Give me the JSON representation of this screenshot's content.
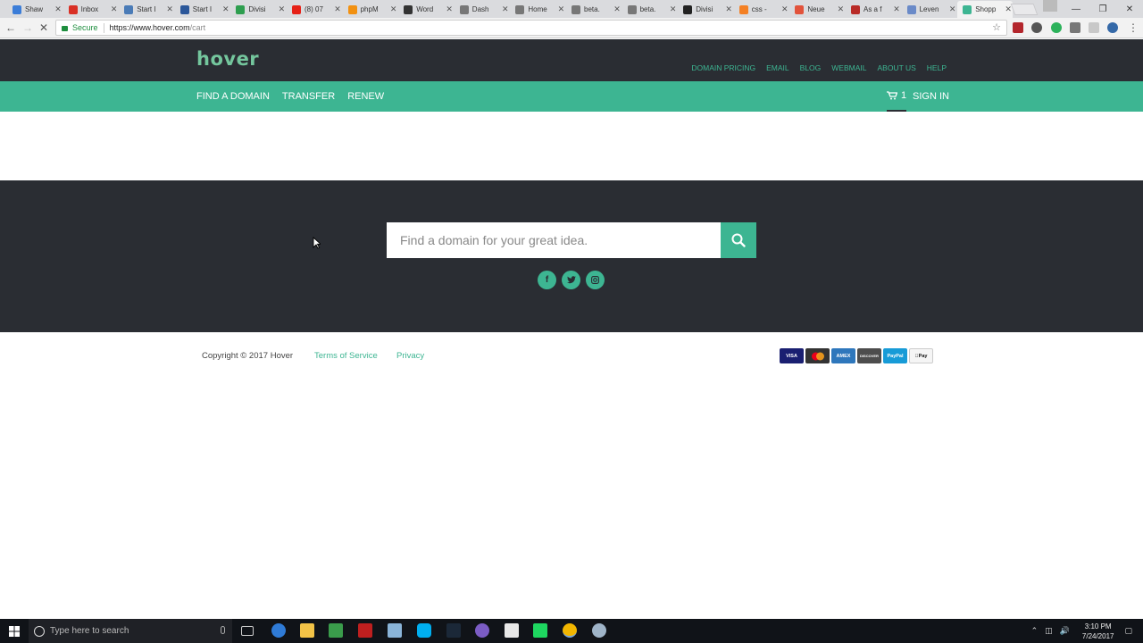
{
  "browser": {
    "tabs": [
      {
        "title": "Shaw",
        "color": "#3b7dd8"
      },
      {
        "title": "Inbox",
        "color": "#d93025"
      },
      {
        "title": "Start I",
        "color": "#4a7bb7"
      },
      {
        "title": "Start I",
        "color": "#2b579a"
      },
      {
        "title": "Divisi",
        "color": "#2e9e4f"
      },
      {
        "title": "(8) 07",
        "color": "#e62117"
      },
      {
        "title": "phpM",
        "color": "#f29111"
      },
      {
        "title": "Word",
        "color": "#333333"
      },
      {
        "title": "Dash",
        "color": "#777777"
      },
      {
        "title": "Home",
        "color": "#777777"
      },
      {
        "title": "beta.",
        "color": "#777777"
      },
      {
        "title": "beta.",
        "color": "#777777"
      },
      {
        "title": "Divisi",
        "color": "#222222"
      },
      {
        "title": "css -",
        "color": "#f48024"
      },
      {
        "title": "Neue",
        "color": "#e2533b"
      },
      {
        "title": "As a f",
        "color": "#b92b27"
      },
      {
        "title": "Leven",
        "color": "#6a8ac8"
      },
      {
        "title": "Shopp",
        "color": "#3db592",
        "active": true
      }
    ],
    "secure_label": "Secure",
    "url_host": "https://www.hover.com",
    "url_path": "/cart"
  },
  "site": {
    "logo": "hover",
    "top_links": [
      "DOMAIN PRICING",
      "EMAIL",
      "BLOG",
      "WEBMAIL",
      "ABOUT US",
      "HELP"
    ],
    "nav": {
      "find": "FIND A DOMAIN",
      "transfer": "TRANSFER",
      "renew": "RENEW",
      "cart_count": "1",
      "sign_in": "SIGN IN"
    },
    "search": {
      "placeholder": "Find a domain for your great idea."
    },
    "socials": [
      "facebook",
      "twitter",
      "instagram"
    ],
    "footer": {
      "copyright": "Copyright © 2017 Hover",
      "terms": "Terms of Service",
      "privacy": "Privacy"
    },
    "payment_cards": [
      {
        "label": "VISA",
        "color": "#1a1f71"
      },
      {
        "label": "MC",
        "color": "#333333"
      },
      {
        "label": "AMEX",
        "color": "#2e77bc"
      },
      {
        "label": "DISCOVER",
        "color": "#4d4d4d"
      },
      {
        "label": "PayPal",
        "color": "#179bd7"
      },
      {
        "label": "Pay",
        "color": "#f5f5f5"
      }
    ],
    "colors": {
      "brand_green": "#3db592",
      "dark": "#2a2d33"
    }
  },
  "taskbar": {
    "search_placeholder": "Type here to search",
    "time": "3:10 PM",
    "date": "7/24/2017"
  }
}
